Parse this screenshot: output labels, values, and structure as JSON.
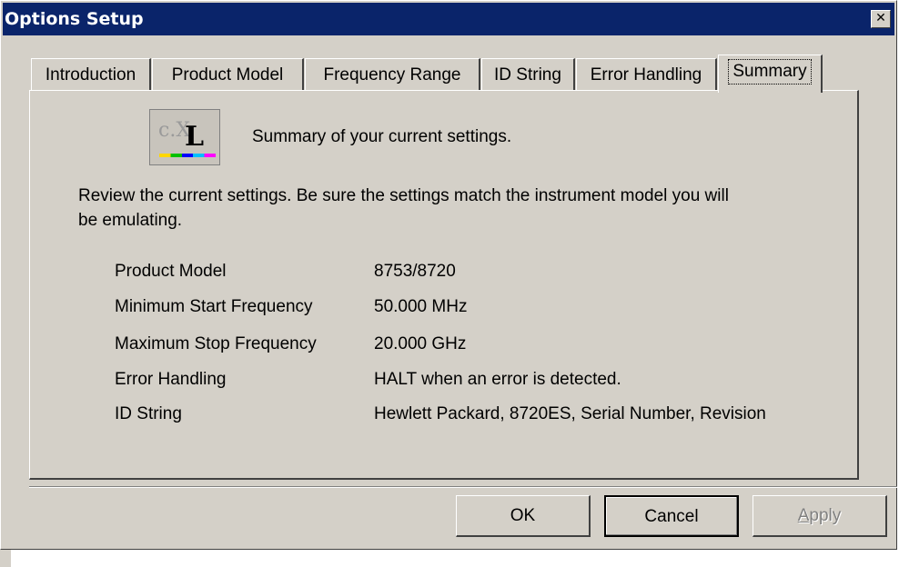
{
  "window": {
    "title": "Options Setup",
    "close_glyph": "✕",
    "close_icon": "close-icon"
  },
  "tabs": [
    {
      "label": "Introduction"
    },
    {
      "label": "Product Model"
    },
    {
      "label": "Frequency Range"
    },
    {
      "label": "ID String"
    },
    {
      "label": "Error Handling"
    },
    {
      "label": "Summary",
      "active": true
    }
  ],
  "summary": {
    "logo_icon": "cxl-logo-icon",
    "logo_text": {
      "left": "c.X",
      "right": "L"
    },
    "heading": "Summary of your current settings.",
    "description_line1": "Review the current settings.  Be sure the settings match the instrument model you will",
    "description_line2": "be emulating.",
    "settings": [
      {
        "label": "Product Model",
        "value": "8753/8720"
      },
      {
        "label": "Minimum Start Frequency",
        "value": "50.000 MHz"
      },
      {
        "label": "Maximum Stop Frequency",
        "value": "20.000 GHz"
      },
      {
        "label": "Error Handling",
        "value": "HALT when an error is detected."
      },
      {
        "label": "ID String",
        "value": "Hewlett Packard, 8720ES, Serial Number, Revision"
      }
    ]
  },
  "buttons": {
    "ok": "OK",
    "cancel": "Cancel",
    "apply_mnemonic": "A",
    "apply_rest": "pply"
  }
}
